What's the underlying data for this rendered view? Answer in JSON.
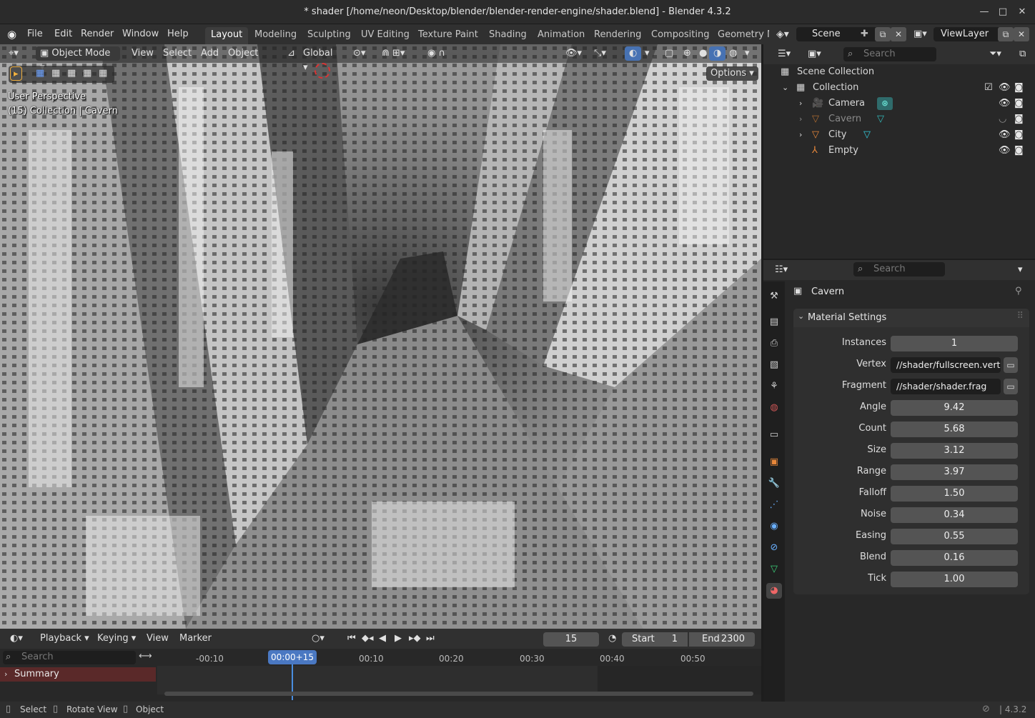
{
  "window": {
    "title": "* shader [/home/neon/Desktop/blender/blender-render-engine/shader.blend] - Blender 4.3.2"
  },
  "menu": [
    "File",
    "Edit",
    "Render",
    "Window",
    "Help"
  ],
  "workspaces": [
    "Layout",
    "Modeling",
    "Sculpting",
    "UV Editing",
    "Texture Paint",
    "Shading",
    "Animation",
    "Rendering",
    "Compositing",
    "Geometry N"
  ],
  "scene": {
    "name": "Scene",
    "view_layer": "ViewLayer"
  },
  "viewport": {
    "mode": "Object Mode",
    "menus": [
      "View",
      "Select",
      "Add",
      "Object"
    ],
    "orientation": "Global",
    "options": "Options",
    "overlay_line1": "User Perspective",
    "overlay_line2": "(15) Collection | Cavern"
  },
  "outliner": {
    "search_placeholder": "Search",
    "scene_collection": "Scene Collection",
    "collection": "Collection",
    "items": [
      {
        "name": "Camera",
        "icon": "camera-icon"
      },
      {
        "name": "Cavern",
        "icon": "mesh-icon",
        "dimmed": true
      },
      {
        "name": "City",
        "icon": "mesh-icon"
      },
      {
        "name": "Empty",
        "icon": "empty-icon"
      }
    ]
  },
  "properties": {
    "search_placeholder": "Search",
    "object_name": "Cavern",
    "panel_title": "Material Settings",
    "fields": [
      {
        "label": "Instances",
        "value": "1"
      },
      {
        "label": "Vertex",
        "value": "//shader/fullscreen.vert",
        "kind": "file"
      },
      {
        "label": "Fragment",
        "value": "//shader/shader.frag",
        "kind": "file"
      },
      {
        "label": "Angle",
        "value": "9.42"
      },
      {
        "label": "Count",
        "value": "5.68"
      },
      {
        "label": "Size",
        "value": "3.12"
      },
      {
        "label": "Range",
        "value": "3.97"
      },
      {
        "label": "Falloff",
        "value": "1.50"
      },
      {
        "label": "Noise",
        "value": "0.34"
      },
      {
        "label": "Easing",
        "value": "0.55"
      },
      {
        "label": "Blend",
        "value": "0.16"
      },
      {
        "label": "Tick",
        "value": "1.00"
      }
    ]
  },
  "timeline": {
    "menus": [
      "Playback",
      "Keying",
      "View",
      "Marker"
    ],
    "current_frame": "15",
    "start_label": "Start",
    "start": "1",
    "end_label": "End",
    "end": "2300",
    "search_placeholder": "Search",
    "summary": "Summary",
    "playhead": "00:00+15",
    "ticks": [
      "-00:10",
      "00:10",
      "00:20",
      "00:30",
      "00:40",
      "00:50"
    ]
  },
  "status": {
    "select": "Select",
    "rotate": "Rotate View",
    "object": "Object",
    "version": "4.3.2"
  }
}
